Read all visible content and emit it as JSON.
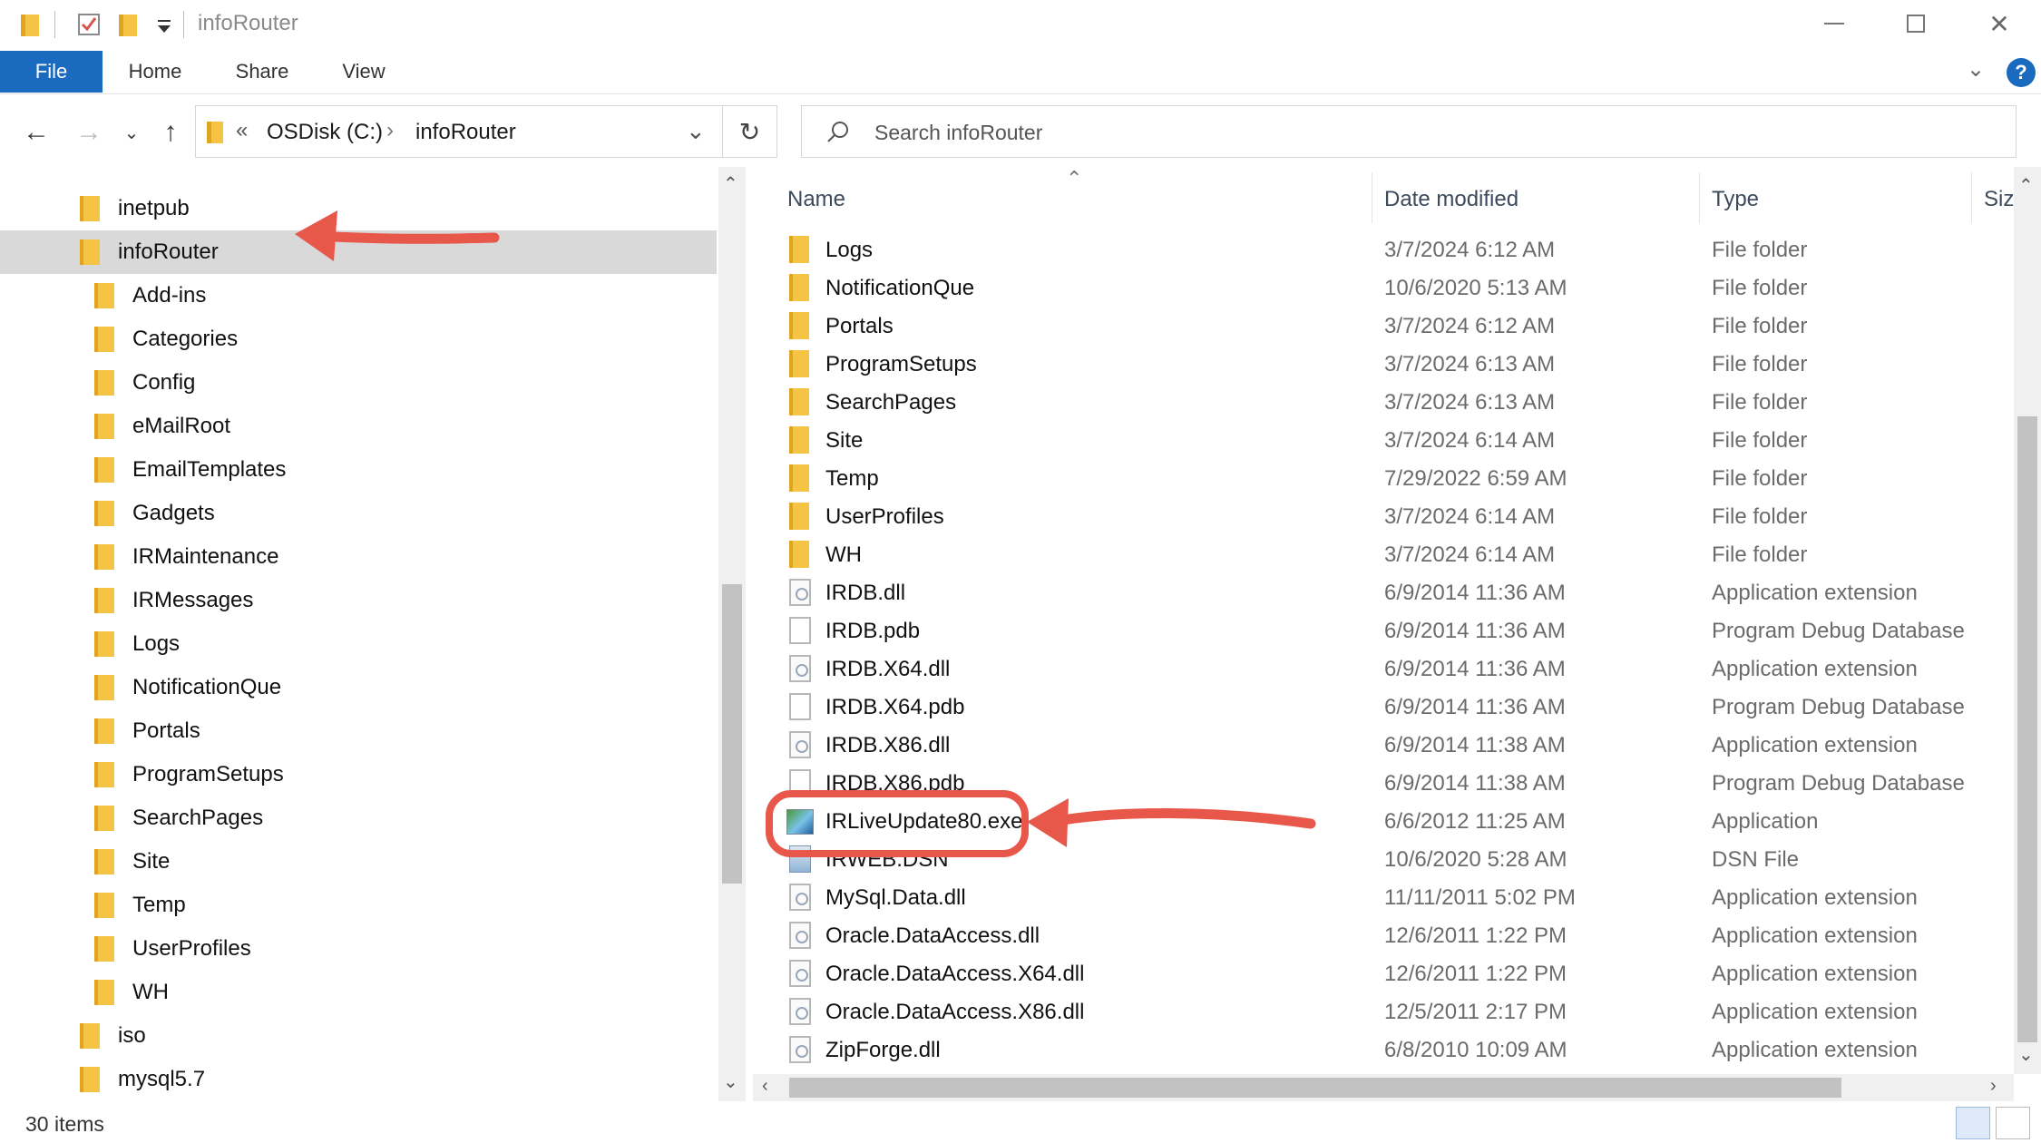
{
  "window": {
    "title": "infoRouter",
    "controls": [
      "minimize-icon",
      "maximize-icon",
      "close-icon"
    ]
  },
  "ribbon": {
    "tabs": [
      "File",
      "Home",
      "Share",
      "View"
    ],
    "help_label": "?"
  },
  "address": {
    "overflow": "«",
    "crumbs": [
      "OSDisk (C:)",
      "infoRouter"
    ],
    "separator": "›"
  },
  "search": {
    "placeholder": "Search infoRouter"
  },
  "nav": {
    "items": [
      {
        "label": "inetpub",
        "indent": 0
      },
      {
        "label": "infoRouter",
        "indent": 0,
        "selected": true
      },
      {
        "label": "Add-ins",
        "indent": 1
      },
      {
        "label": "Categories",
        "indent": 1
      },
      {
        "label": "Config",
        "indent": 1
      },
      {
        "label": "eMailRoot",
        "indent": 1
      },
      {
        "label": "EmailTemplates",
        "indent": 1
      },
      {
        "label": "Gadgets",
        "indent": 1
      },
      {
        "label": "IRMaintenance",
        "indent": 1
      },
      {
        "label": "IRMessages",
        "indent": 1
      },
      {
        "label": "Logs",
        "indent": 1
      },
      {
        "label": "NotificationQue",
        "indent": 1
      },
      {
        "label": "Portals",
        "indent": 1
      },
      {
        "label": "ProgramSetups",
        "indent": 1
      },
      {
        "label": "SearchPages",
        "indent": 1
      },
      {
        "label": "Site",
        "indent": 1
      },
      {
        "label": "Temp",
        "indent": 1
      },
      {
        "label": "UserProfiles",
        "indent": 1
      },
      {
        "label": "WH",
        "indent": 1
      },
      {
        "label": "iso",
        "indent": 0
      },
      {
        "label": "mysql5.7",
        "indent": 0
      }
    ]
  },
  "columns": {
    "name": "Name",
    "date": "Date modified",
    "type": "Type",
    "size": "Siz"
  },
  "files": [
    {
      "name": "Logs",
      "date": "3/7/2024 6:12 AM",
      "type": "File folder",
      "icon": "folder"
    },
    {
      "name": "NotificationQue",
      "date": "10/6/2020 5:13 AM",
      "type": "File folder",
      "icon": "folder"
    },
    {
      "name": "Portals",
      "date": "3/7/2024 6:12 AM",
      "type": "File folder",
      "icon": "folder"
    },
    {
      "name": "ProgramSetups",
      "date": "3/7/2024 6:13 AM",
      "type": "File folder",
      "icon": "folder"
    },
    {
      "name": "SearchPages",
      "date": "3/7/2024 6:13 AM",
      "type": "File folder",
      "icon": "folder"
    },
    {
      "name": "Site",
      "date": "3/7/2024 6:14 AM",
      "type": "File folder",
      "icon": "folder"
    },
    {
      "name": "Temp",
      "date": "7/29/2022 6:59 AM",
      "type": "File folder",
      "icon": "folder"
    },
    {
      "name": "UserProfiles",
      "date": "3/7/2024 6:14 AM",
      "type": "File folder",
      "icon": "folder"
    },
    {
      "name": "WH",
      "date": "3/7/2024 6:14 AM",
      "type": "File folder",
      "icon": "folder"
    },
    {
      "name": "IRDB.dll",
      "date": "6/9/2014 11:36 AM",
      "type": "Application extension",
      "icon": "dll"
    },
    {
      "name": "IRDB.pdb",
      "date": "6/9/2014 11:36 AM",
      "type": "Program Debug Database",
      "icon": "pdb"
    },
    {
      "name": "IRDB.X64.dll",
      "date": "6/9/2014 11:36 AM",
      "type": "Application extension",
      "icon": "dll"
    },
    {
      "name": "IRDB.X64.pdb",
      "date": "6/9/2014 11:36 AM",
      "type": "Program Debug Database",
      "icon": "pdb"
    },
    {
      "name": "IRDB.X86.dll",
      "date": "6/9/2014 11:38 AM",
      "type": "Application extension",
      "icon": "dll"
    },
    {
      "name": "IRDB.X86.pdb",
      "date": "6/9/2014 11:38 AM",
      "type": "Program Debug Database",
      "icon": "pdb"
    },
    {
      "name": "IRLiveUpdate80.exe",
      "date": "6/6/2012 11:25 AM",
      "type": "Application",
      "icon": "exe"
    },
    {
      "name": "IRWEB.DSN",
      "date": "10/6/2020 5:28 AM",
      "type": "DSN File",
      "icon": "dsn"
    },
    {
      "name": "MySql.Data.dll",
      "date": "11/11/2011 5:02 PM",
      "type": "Application extension",
      "icon": "dll"
    },
    {
      "name": "Oracle.DataAccess.dll",
      "date": "12/6/2011 1:22 PM",
      "type": "Application extension",
      "icon": "dll"
    },
    {
      "name": "Oracle.DataAccess.X64.dll",
      "date": "12/6/2011 1:22 PM",
      "type": "Application extension",
      "icon": "dll"
    },
    {
      "name": "Oracle.DataAccess.X86.dll",
      "date": "12/5/2011 2:17 PM",
      "type": "Application extension",
      "icon": "dll"
    },
    {
      "name": "ZipForge.dll",
      "date": "6/8/2010 10:09 AM",
      "type": "Application extension",
      "icon": "dll"
    }
  ],
  "status": {
    "count": "30 items"
  },
  "annotation": {
    "color": "#e8584a",
    "highlighted_file": "IRLiveUpdate80.exe",
    "highlighted_folder": "infoRouter"
  }
}
